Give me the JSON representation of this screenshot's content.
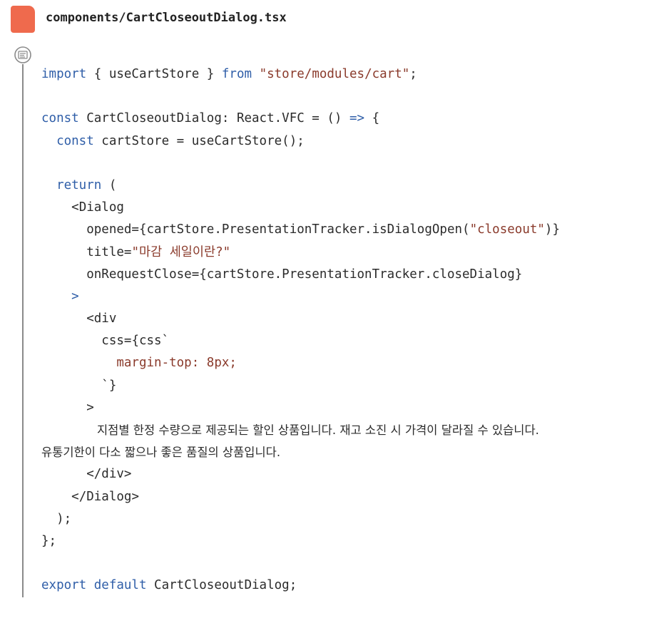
{
  "file": {
    "title": "components/CartCloseoutDialog.tsx",
    "icon": "code-listing-icon",
    "accent": "#ef6a4d"
  },
  "code": {
    "import_kw": "import",
    "import_names": " { useCartStore } ",
    "from_kw": "from",
    "import_path": " \"store/modules/cart\"",
    "import_end": ";",
    "const_kw": "const",
    "component_decl": " CartCloseoutDialog: React.VFC = () ",
    "arrow": "=>",
    "brace_open": " {",
    "const2_kw": "const",
    "store_decl": " cartStore = useCartStore();",
    "return_kw": "return",
    "paren_open": " (",
    "dialog_open": "<Dialog",
    "opened_attr": "opened={cartStore.PresentationTracker.isDialogOpen(",
    "opened_arg": "\"closeout\"",
    "opened_end": ")}",
    "title_attr": "title=",
    "title_value": "\"마감 세일이란?\"",
    "close_attr": "onRequestClose={cartStore.PresentationTracker.closeDialog}",
    "tag_close": ">",
    "div_open": "<div",
    "css_attr": "css={css`",
    "css_rule": "margin-top: 8px;",
    "css_end": "`}",
    "div_tag_close": ">",
    "body_text_1": "지점별 한정 수량으로 제공되는 할인 상품입니다. 재고 소진 시 가격이 달라질 수 있습니다.",
    "body_text_2": "유통기한이 다소 짧으나 좋은 품질의 상품입니다.",
    "div_close": "</div>",
    "dialog_close": "</Dialog>",
    "paren_close": ");",
    "brace_close": "};",
    "export_kw": "export default",
    "export_name": " CartCloseoutDialog;"
  }
}
